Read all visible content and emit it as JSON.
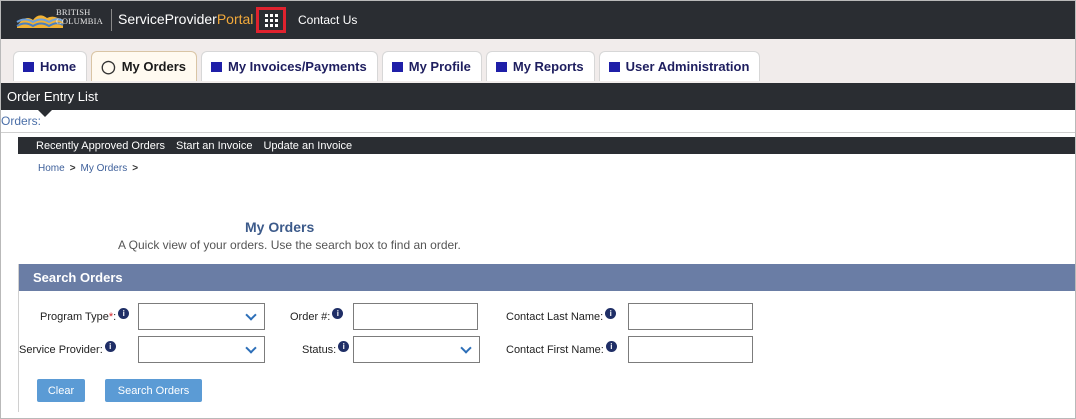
{
  "header": {
    "logo_line1": "BRITISH",
    "logo_line2": "COLUMBIA",
    "portal_prefix": "ServiceProvider",
    "portal_accent": "Portal",
    "apps_icon": "grid-icon",
    "contact": "Contact Us"
  },
  "tabs": [
    {
      "label": "Home",
      "icon": "square-icon"
    },
    {
      "label": "My Orders",
      "icon": "tag-icon",
      "active": true
    },
    {
      "label": "My Invoices/Payments",
      "icon": "square-icon"
    },
    {
      "label": "My Profile",
      "icon": "square-icon"
    },
    {
      "label": "My Reports",
      "icon": "square-icon"
    },
    {
      "label": "User Administration",
      "icon": "square-icon"
    }
  ],
  "section_title": "Order Entry List",
  "orders_label": "Orders:",
  "subnav": [
    "Recently Approved Orders",
    "Start an Invoice",
    "Update an Invoice"
  ],
  "breadcrumb": [
    "Home",
    "My Orders"
  ],
  "breadcrumb_sep": ">",
  "page": {
    "title": "My Orders",
    "subtitle": "A Quick view of your orders. Use the search box to find an order."
  },
  "search": {
    "title": "Search Orders",
    "program_type_label": "Program Type",
    "required_mark": "*",
    "label_suffix": ":",
    "program_type_value": "",
    "service_provider_label": "Service Provider:",
    "service_provider_value": "",
    "order_num_label": "Order #:",
    "order_num_value": "",
    "status_label": "Status:",
    "status_value": "",
    "contact_last_label": "Contact Last Name:",
    "contact_last_value": "",
    "contact_first_label": "Contact First Name:",
    "contact_first_value": "",
    "info_glyph": "i",
    "clear_button": "Clear",
    "search_button": "Search Orders"
  },
  "colors": {
    "dark_bar": "#2a2d32",
    "accent_orange": "#f2a93b",
    "tab_square": "#1f1fa8",
    "panel_header": "#6a7da5",
    "button": "#5b9bd5",
    "highlight_box": "#e0222e"
  }
}
